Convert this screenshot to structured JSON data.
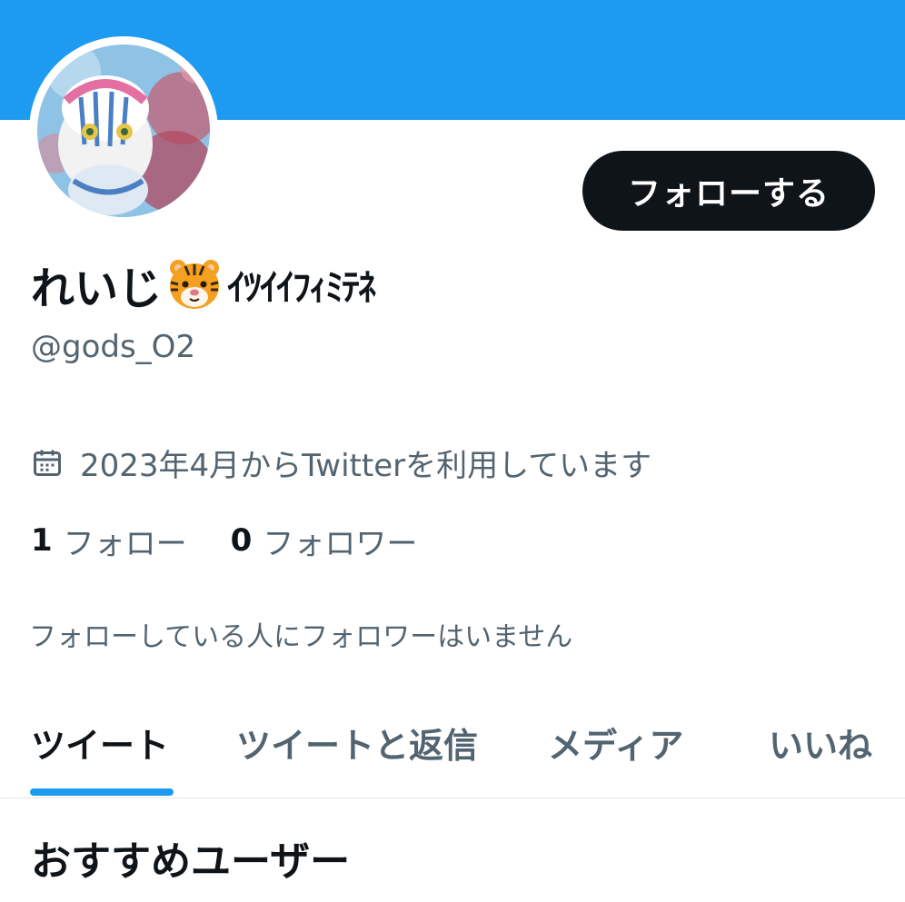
{
  "profile": {
    "display_name": "れいじ",
    "name_emoji": "tiger-face-emoji",
    "name_suffix": "ｲﾂｲｲﾌｨﾐﾃﾈ",
    "handle": "@gods_O2",
    "joined": "2023年4月からTwitterを利用しています",
    "follow_button": "フォローする",
    "following_count": "1",
    "following_label": "フォロー",
    "followers_count": "0",
    "followers_label": "フォロワー",
    "no_mutual_text": "フォローしている人にフォロワーはいません"
  },
  "tabs": [
    {
      "label": "ツイート",
      "active": true
    },
    {
      "label": "ツイートと返信",
      "active": false
    },
    {
      "label": "メディア",
      "active": false
    },
    {
      "label": "いいね",
      "active": false
    }
  ],
  "recommended": {
    "title": "おすすめユーザー"
  },
  "colors": {
    "accent": "#1d9bf0",
    "text_primary": "#0f1419",
    "text_secondary": "#536471",
    "button_bg": "#0f1419"
  },
  "icons": {
    "joined": "calendar-icon"
  }
}
